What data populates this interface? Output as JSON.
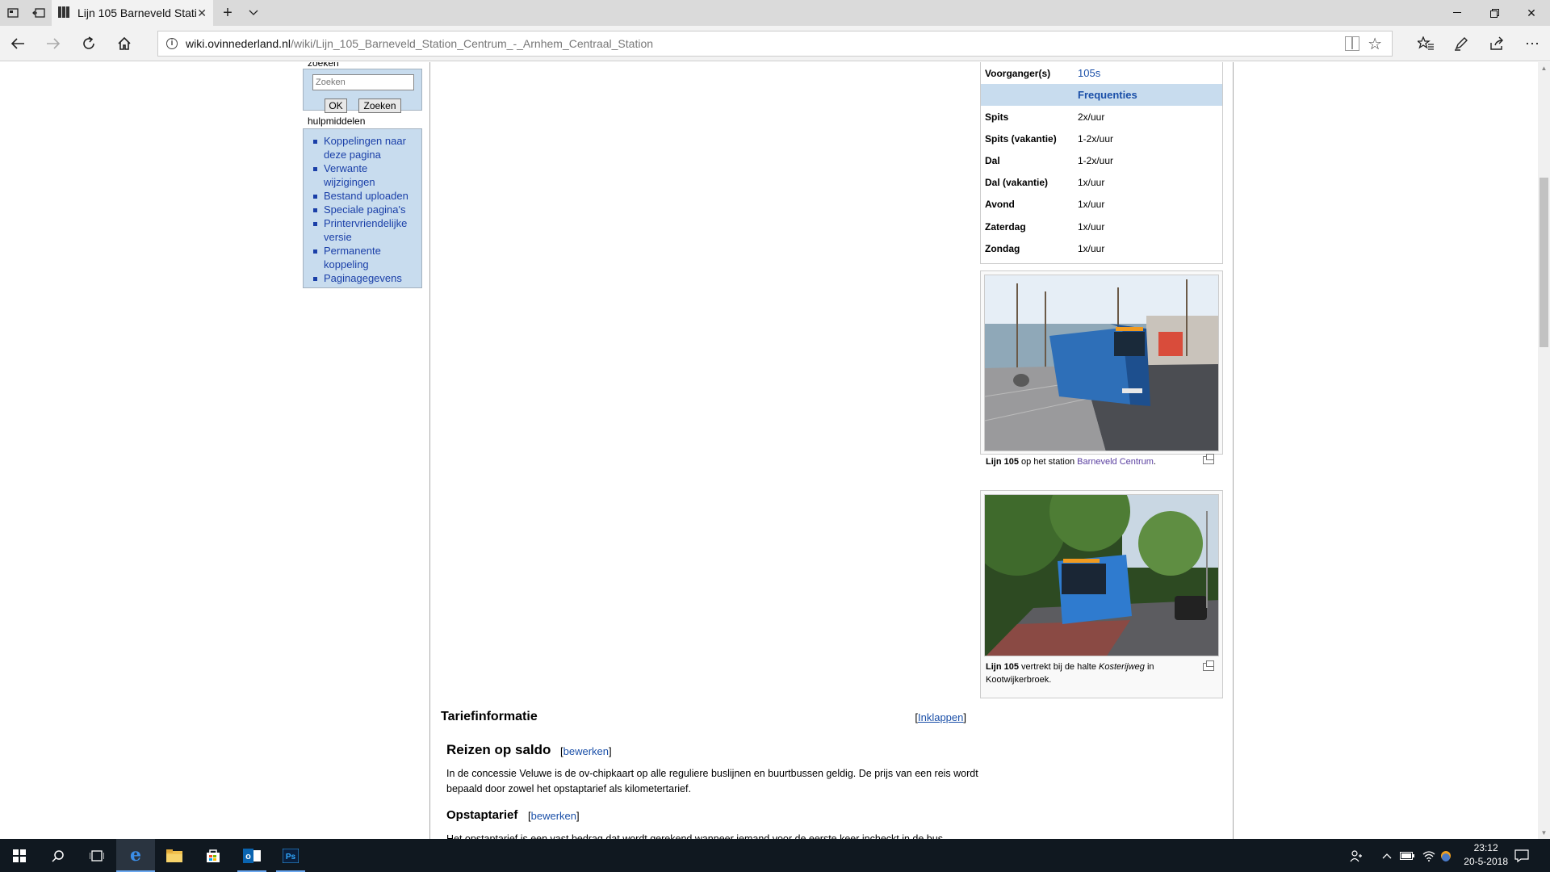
{
  "browser": {
    "tab_title": "Lijn 105 Barneveld Stati",
    "new_tab_label": "+",
    "address_domain": "wiki.ovinnederland.nl",
    "address_path": "/wiki/Lijn_105_Barneveld_Station_Centrum_-_Arnhem_Centraal_Station"
  },
  "sidebar": {
    "search_label": "zoeken",
    "search_placeholder": "Zoeken",
    "ok_label": "OK",
    "search_button_label": "Zoeken",
    "tools_label": "hulpmiddelen",
    "tools": [
      {
        "line1": "Koppelingen naar",
        "line2": "deze pagina"
      },
      {
        "line1": "Verwante",
        "line2": "wijzigingen"
      },
      {
        "line1": "Bestand uploaden",
        "line2": ""
      },
      {
        "line1": "Speciale pagina's",
        "line2": ""
      },
      {
        "line1": "Printervriendelijke",
        "line2": "versie"
      },
      {
        "line1": "Permanente",
        "line2": "koppeling"
      },
      {
        "line1": "Paginagegevens",
        "line2": ""
      }
    ]
  },
  "infobox": {
    "predecessor_key": "Voorganger(s)",
    "predecessor_value": "105s",
    "freq_header": "Frequenties",
    "rows": [
      {
        "key": "Spits",
        "value": "2x/uur"
      },
      {
        "key": "Spits (vakantie)",
        "value": "1-2x/uur"
      },
      {
        "key": "Dal",
        "value": "1-2x/uur"
      },
      {
        "key": "Dal (vakantie)",
        "value": "1x/uur"
      },
      {
        "key": "Avond",
        "value": "1x/uur"
      },
      {
        "key": "Zaterdag",
        "value": "1x/uur"
      },
      {
        "key": "Zondag",
        "value": "1x/uur"
      }
    ]
  },
  "thumbs": {
    "one": {
      "bold": "Lijn 105",
      "text": " op het station ",
      "link": "Barneveld Centrum",
      "end": "."
    },
    "two": {
      "bold": "Lijn 105",
      "text": " vertrekt bij de halte ",
      "italic": "Kosterijweg",
      "end": " in Kootwijkerbroek."
    }
  },
  "article": {
    "tarief_heading": "Tariefinformatie",
    "collapse_label": "Inklappen",
    "saldo_heading": "Reizen op saldo",
    "edit_label": "bewerken",
    "saldo_text": "In de concessie Veluwe is de ov-chipkaart op alle reguliere buslijnen en buurtbussen geldig. De prijs van een reis wordt bepaald door zowel het opstaptarief als kilometertarief.",
    "opstap_heading": "Opstaptarief",
    "opstap_text": "Het opstaptarief is een vast bedrag dat wordt gerekend wanneer iemand voor de eerste keer incheckt in de bus."
  },
  "taskbar": {
    "time": "23:12",
    "date": "20-5-2018"
  },
  "colors": {
    "link": "#1a4fa8",
    "sidebar_bg": "#c8dcee",
    "taskbar_bg": "#101820"
  }
}
